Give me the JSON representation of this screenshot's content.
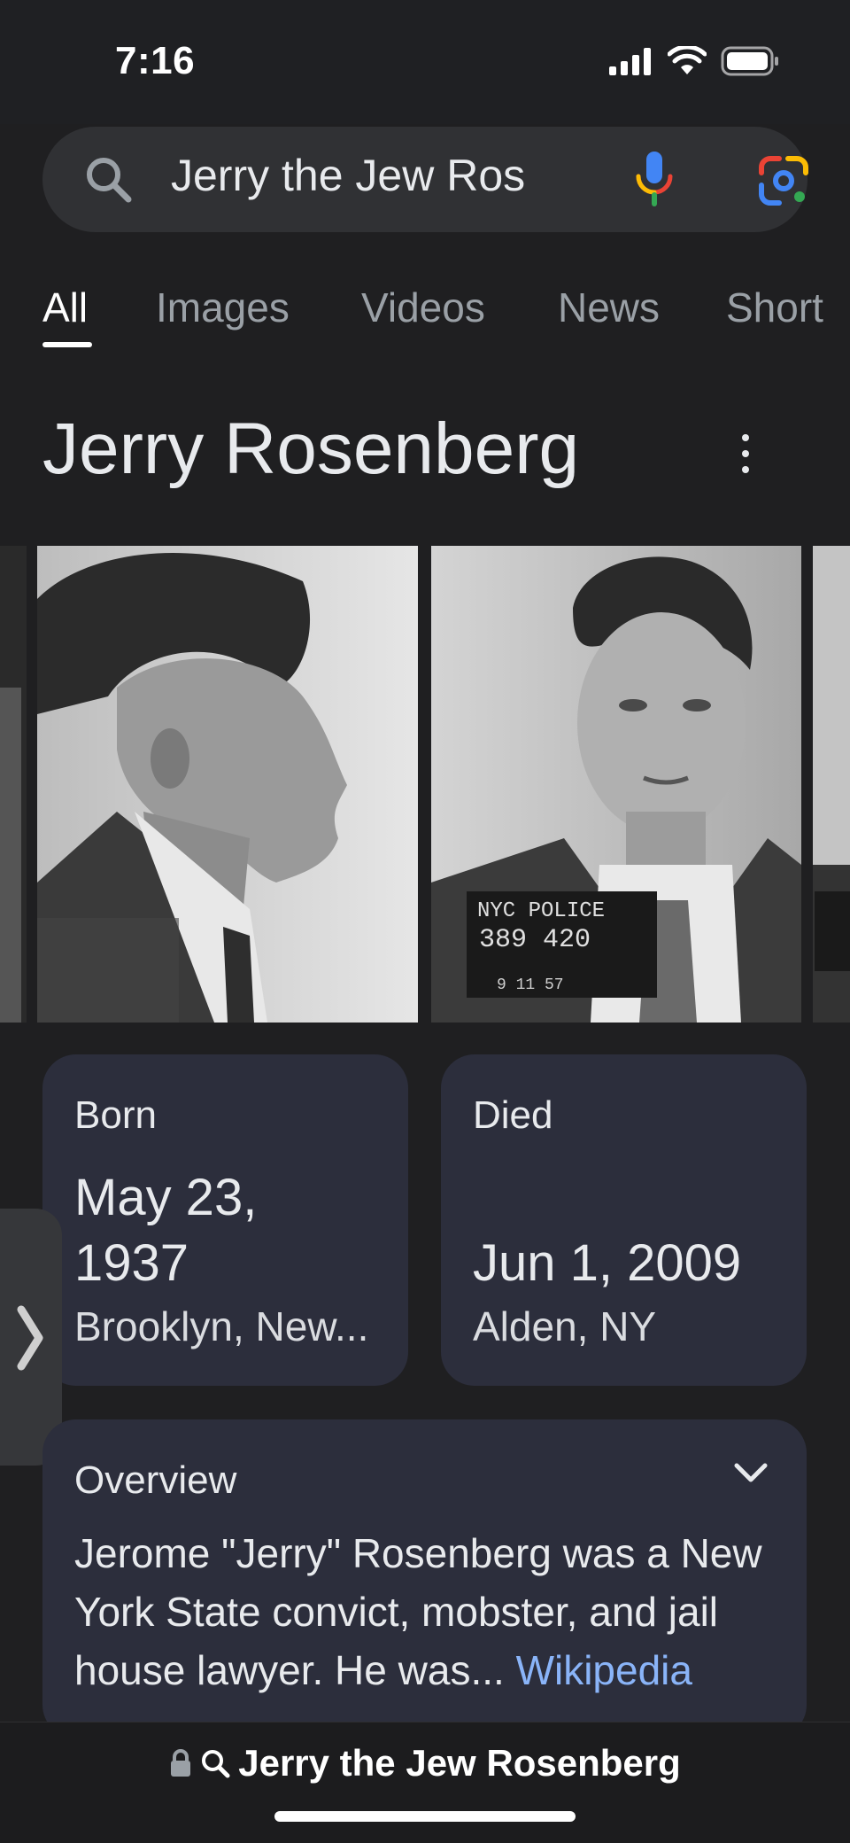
{
  "status": {
    "time": "7:16"
  },
  "search": {
    "query": "Jerry the Jew Ros"
  },
  "tabs": [
    {
      "label": "All",
      "active": true
    },
    {
      "label": "Images"
    },
    {
      "label": "Videos"
    },
    {
      "label": "News"
    },
    {
      "label": "Short"
    }
  ],
  "knowledge_panel": {
    "title": "Jerry Rosenberg",
    "born": {
      "label": "Born",
      "date_line1": "May 23,",
      "date_line2": "1937",
      "place": "Brooklyn, New..."
    },
    "died": {
      "label": "Died",
      "date": "Jun 1, 2009",
      "place": "Alden, NY"
    },
    "overview": {
      "label": "Overview",
      "text": "Jerome \"Jerry\" Rosenberg was a New York State convict, mobster, and jail house lawyer. He was... ",
      "source": "Wikipedia"
    },
    "mugshot": {
      "line1": "NYC POLICE",
      "line2": "389 420",
      "line3": "9 11 57"
    }
  },
  "bottom_bar": {
    "url_text": "Jerry the Jew Rosenberg"
  },
  "colors": {
    "card_bg": "#2c2e3c",
    "link": "#8ab4f8",
    "page_bg": "#1f1f21"
  }
}
